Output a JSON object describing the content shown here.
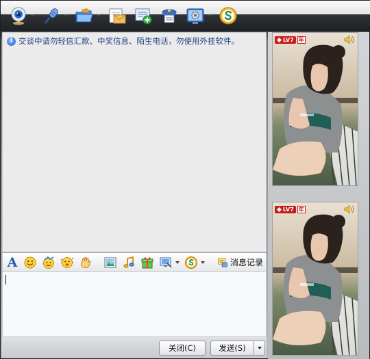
{
  "notice": {
    "text": "交谈中请勿轻信汇款、中奖信息、陌生电话，勿使用外挂软件。"
  },
  "toolbar": {
    "buttons": [
      {
        "name": "video-call",
        "icon": "webcam-icon",
        "has_dropdown": true
      },
      {
        "name": "voice-call",
        "icon": "microphone-icon",
        "has_dropdown": true
      },
      {
        "name": "send-file",
        "icon": "folder-icon",
        "has_dropdown": true
      },
      {
        "name": "send-mail",
        "icon": "mail-icon",
        "has_dropdown": false
      },
      {
        "name": "create-group",
        "icon": "add-chat-icon",
        "has_dropdown": false
      },
      {
        "name": "app",
        "icon": "app-icon",
        "has_dropdown": false
      },
      {
        "name": "settings",
        "icon": "settings-icon",
        "has_dropdown": true
      },
      {
        "name": "soso",
        "icon": "soso-icon",
        "has_dropdown": false
      }
    ]
  },
  "input_toolbar": {
    "font_label": "A",
    "message_record_label": "消息记录"
  },
  "buttons": {
    "close_label": "关闭(C)",
    "send_label": "发送(S)"
  },
  "video_panels": [
    {
      "level": "LV7",
      "year_badge": "年"
    },
    {
      "level": "LV7",
      "year_badge": "年"
    }
  ],
  "colors": {
    "notice_text": "#1d3f80",
    "accent_blue": "#2a5cb3",
    "badge_red": "#c81c1c"
  }
}
